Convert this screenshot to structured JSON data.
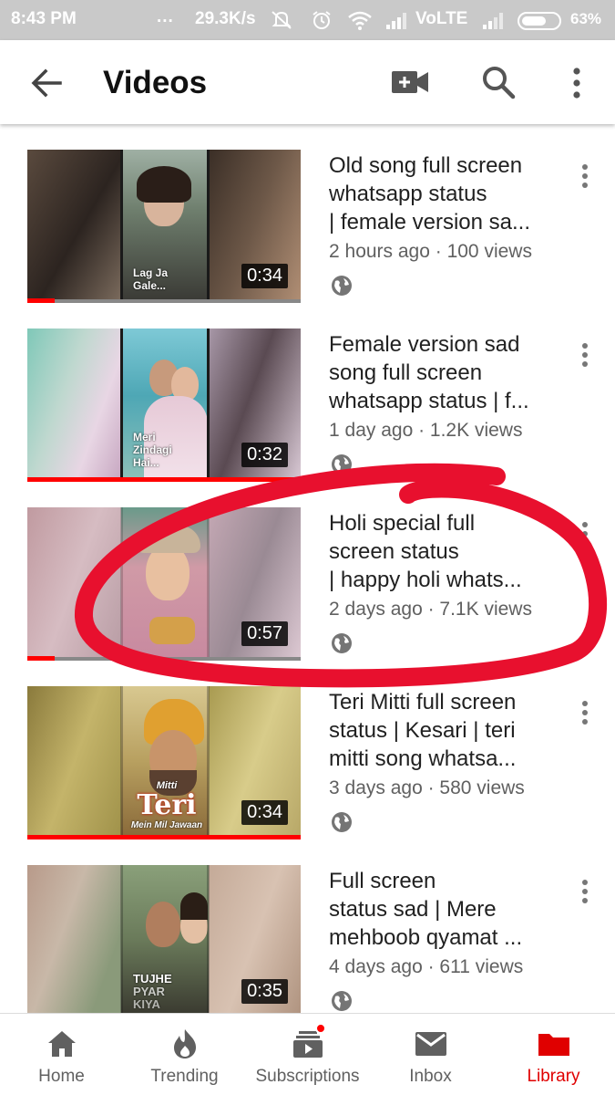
{
  "status_bar": {
    "time": "8:43 PM",
    "dots": "...",
    "speed": "29.3K/s",
    "network": "VoLTE",
    "battery": "63%"
  },
  "app_bar": {
    "title": "Videos"
  },
  "videos": [
    {
      "title_lines": [
        "Old song full screen",
        "whatsapp status",
        "| female version sa..."
      ],
      "meta": "2 hours ago · 100 views",
      "duration": "0:34",
      "caption": [
        "Lag Ja",
        "Gale..."
      ],
      "progress_fraction": 0.1
    },
    {
      "title_lines": [
        "Female version sad",
        "song full screen",
        "whatsapp status | f..."
      ],
      "meta": "1 day ago · 1.2K views",
      "duration": "0:32",
      "caption": [
        "Meri",
        "Zindagi",
        "Hai..."
      ],
      "progress_fraction": 1.0
    },
    {
      "title_lines": [
        "Holi special full",
        "screen status",
        "| happy holi whats..."
      ],
      "meta": "2 days ago · 7.1K views",
      "duration": "0:57",
      "caption": [],
      "progress_fraction": 0.1
    },
    {
      "title_lines": [
        "Teri Mitti full screen",
        "status | Kesari | teri",
        "mitti song whatsa..."
      ],
      "meta": "3 days ago · 580 views",
      "duration": "0:34",
      "caption": [
        "Mitti",
        "Teri",
        "Mein Mil Jawaan"
      ],
      "progress_fraction": 1.0
    },
    {
      "title_lines": [
        "Full screen",
        "status sad | Mere",
        "mehboob qyamat ..."
      ],
      "meta": "4 days ago · 611 views",
      "duration": "0:35",
      "caption": [
        "TUJHE",
        "PYAR",
        "KIYA"
      ],
      "progress_fraction": 0.1
    }
  ],
  "bottom_nav": [
    {
      "label": "Home",
      "icon": "home-icon"
    },
    {
      "label": "Trending",
      "icon": "flame-icon"
    },
    {
      "label": "Subscriptions",
      "icon": "subscriptions-icon"
    },
    {
      "label": "Inbox",
      "icon": "mail-icon"
    },
    {
      "label": "Library",
      "icon": "folder-icon"
    }
  ],
  "colors": {
    "accent": "#e00000",
    "annotation": "#e8102e",
    "status_bar": "#c9c9c9"
  }
}
